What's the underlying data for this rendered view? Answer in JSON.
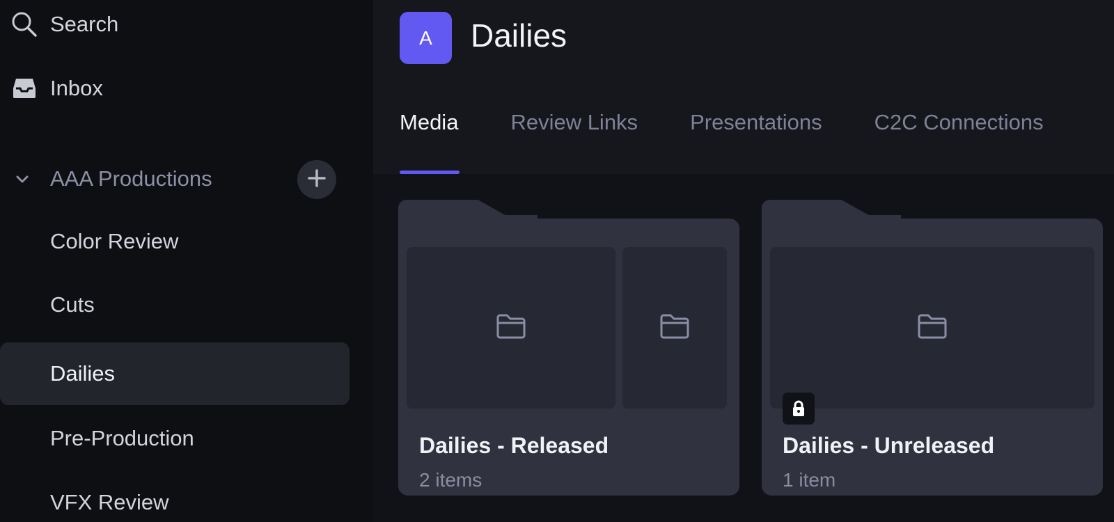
{
  "sidebar": {
    "search": {
      "label": "Search",
      "icon": "search-icon"
    },
    "inbox": {
      "label": "Inbox",
      "icon": "inbox-icon"
    },
    "team": {
      "label": "AAA Productions",
      "expand_icon": "chevron-down-icon",
      "add_icon": "plus-icon"
    },
    "projects": [
      {
        "label": "Color Review",
        "active": false
      },
      {
        "label": "Cuts",
        "active": false
      },
      {
        "label": "Dailies",
        "active": true
      },
      {
        "label": "Pre-Production",
        "active": false
      },
      {
        "label": "VFX Review",
        "active": false
      }
    ]
  },
  "header": {
    "avatar_letter": "A",
    "title": "Dailies",
    "tabs": [
      {
        "label": "Media",
        "active": true
      },
      {
        "label": "Review Links",
        "active": false
      },
      {
        "label": "Presentations",
        "active": false
      },
      {
        "label": "C2C Connections",
        "active": false
      }
    ]
  },
  "folders": [
    {
      "name": "Dailies - Released",
      "count": "2 items",
      "locked": false,
      "thumb_icon": "folder-icon"
    },
    {
      "name": "Dailies - Unreleased",
      "count": "1 item",
      "locked": true,
      "thumb_icon": "folder-icon",
      "lock_icon": "lock-icon"
    }
  ],
  "colors": {
    "accent": "#6259f2",
    "sidebar_bg": "#0e0f13",
    "card_bg": "#30323f",
    "thumb_bg": "#262834"
  }
}
